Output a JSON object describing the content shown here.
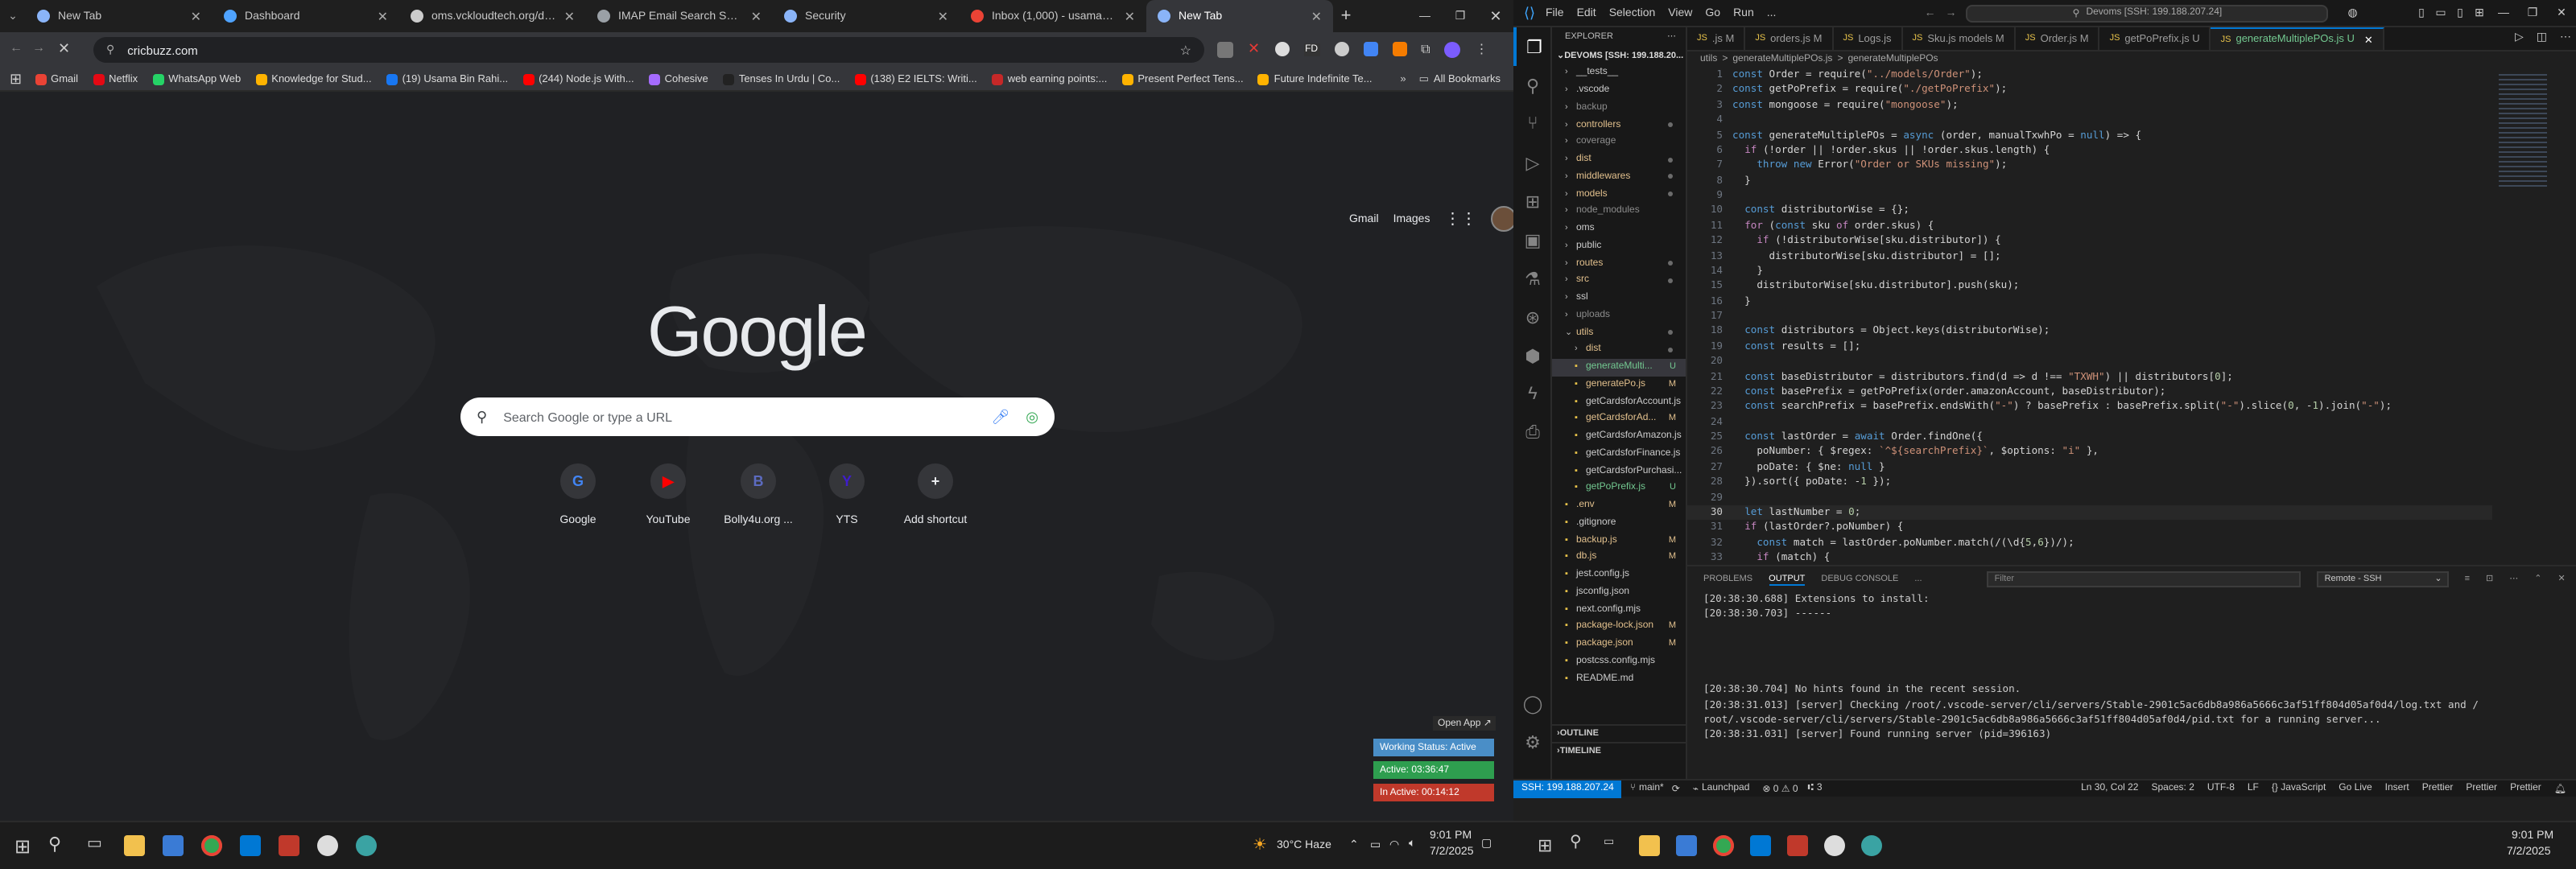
{
  "chrome": {
    "tabs": [
      {
        "label": "New Tab",
        "color": "#8ab4f8",
        "active": false
      },
      {
        "label": "Dashboard",
        "color": "#4fa3ff",
        "active": false
      },
      {
        "label": "oms.vckloudtech.org/dashboard",
        "color": "#cccccc",
        "active": false
      },
      {
        "label": "IMAP Email Search Script",
        "color": "#9aa0a6",
        "active": false
      },
      {
        "label": "Security",
        "color": "#8ab4f8",
        "active": false
      },
      {
        "label": "Inbox (1,000) - usamabin2580...",
        "color": "#ea4335",
        "active": false
      },
      {
        "label": "New Tab",
        "color": "#8ab4f8",
        "active": true
      }
    ],
    "url": "cricbuzz.com",
    "bookmarks": [
      {
        "label": "Gmail",
        "color": "#ea4335"
      },
      {
        "label": "Netflix",
        "color": "#e50914"
      },
      {
        "label": "WhatsApp Web",
        "color": "#25d366"
      },
      {
        "label": "Knowledge for Stud...",
        "color": "#ffb300"
      },
      {
        "label": "(19) Usama Bin Rahi...",
        "color": "#1877f2"
      },
      {
        "label": "(244) Node.js With...",
        "color": "#ff0000"
      },
      {
        "label": "Cohesive",
        "color": "#a56bff"
      },
      {
        "label": "Tenses In Urdu | Co...",
        "color": "#222222"
      },
      {
        "label": "(138) E2 IELTS: Writi...",
        "color": "#ff0000"
      },
      {
        "label": "web earning points:...",
        "color": "#c62828"
      },
      {
        "label": "Present Perfect Tens...",
        "color": "#ffb300"
      },
      {
        "label": "Future Indefinite Te...",
        "color": "#ffb300"
      }
    ],
    "all_bookmarks": "All Bookmarks",
    "gmail": "Gmail",
    "images": "Images",
    "logo": "Google",
    "search_placeholder": "Search Google or type a URL",
    "shortcuts": [
      {
        "label": "Google",
        "glyph": "G",
        "color": "#4285f4"
      },
      {
        "label": "YouTube",
        "glyph": "▶",
        "color": "#ff0000"
      },
      {
        "label": "Bolly4u.org ...",
        "glyph": "B",
        "color": "#5c6bc0"
      },
      {
        "label": "YTS",
        "glyph": "Y",
        "color": "#3f1dcb"
      },
      {
        "label": "Add shortcut",
        "glyph": "+",
        "color": "#e8eaed"
      }
    ],
    "open_app": "Open App ↗",
    "working_status": "Working Status: Active",
    "active_time": "Active: 03:36:47",
    "inactive_time": "In Active: 00:14:12"
  },
  "taskbar": {
    "weather": "30°C  Haze",
    "time_left": "9:01 PM",
    "date_left": "7/2/2025",
    "time_right": "9:01 PM",
    "date_right": "7/2/2025"
  },
  "vscode": {
    "menu": [
      "File",
      "Edit",
      "Selection",
      "View",
      "Go",
      "Run",
      "..."
    ],
    "command_center": "Devoms [SSH: 199.188.207.24]",
    "explorer_title": "EXPLORER",
    "root": "DEVOMS [SSH: 199.188.20...",
    "tree": [
      {
        "label": "__tests__",
        "indent": 1,
        "folder": true,
        "color": "#cccccc",
        "mark": ""
      },
      {
        "label": ".vscode",
        "indent": 1,
        "folder": true,
        "color": "#cccccc",
        "mark": ""
      },
      {
        "label": "backup",
        "indent": 1,
        "folder": true,
        "color": "#8c8c8c",
        "mark": ""
      },
      {
        "label": "controllers",
        "indent": 1,
        "folder": true,
        "color": "#e2c08d",
        "mark": "dot"
      },
      {
        "label": "coverage",
        "indent": 1,
        "folder": true,
        "color": "#8c8c8c",
        "mark": ""
      },
      {
        "label": "dist",
        "indent": 1,
        "folder": true,
        "color": "#e2c08d",
        "mark": "dot"
      },
      {
        "label": "middlewares",
        "indent": 1,
        "folder": true,
        "color": "#e2c08d",
        "mark": "dot"
      },
      {
        "label": "models",
        "indent": 1,
        "folder": true,
        "color": "#e2c08d",
        "mark": "dot"
      },
      {
        "label": "node_modules",
        "indent": 1,
        "folder": true,
        "color": "#8c8c8c",
        "mark": ""
      },
      {
        "label": "oms",
        "indent": 1,
        "folder": true,
        "color": "#cccccc",
        "mark": ""
      },
      {
        "label": "public",
        "indent": 1,
        "folder": true,
        "color": "#cccccc",
        "mark": ""
      },
      {
        "label": "routes",
        "indent": 1,
        "folder": true,
        "color": "#e2c08d",
        "mark": "dot"
      },
      {
        "label": "src",
        "indent": 1,
        "folder": true,
        "color": "#e2c08d",
        "mark": "dot"
      },
      {
        "label": "ssl",
        "indent": 1,
        "folder": true,
        "color": "#cccccc",
        "mark": ""
      },
      {
        "label": "uploads",
        "indent": 1,
        "folder": true,
        "color": "#8c8c8c",
        "mark": ""
      },
      {
        "label": "utils",
        "indent": 1,
        "folder": true,
        "color": "#e2c08d",
        "mark": "dot",
        "open": true
      },
      {
        "label": "dist",
        "indent": 2,
        "folder": true,
        "color": "#e2c08d",
        "mark": "dot"
      },
      {
        "label": "generateMulti...",
        "indent": 2,
        "folder": false,
        "color": "#73c991",
        "mark": "U",
        "selected": true
      },
      {
        "label": "generatePo.js",
        "indent": 2,
        "folder": false,
        "color": "#e2c08d",
        "mark": "M"
      },
      {
        "label": "getCardsforAccount.js",
        "indent": 2,
        "folder": false,
        "color": "#cccccc",
        "mark": ""
      },
      {
        "label": "getCardsforAd...",
        "indent": 2,
        "folder": false,
        "color": "#e2c08d",
        "mark": "M"
      },
      {
        "label": "getCardsforAmazon.js",
        "indent": 2,
        "folder": false,
        "color": "#cccccc",
        "mark": ""
      },
      {
        "label": "getCardsforFinance.js",
        "indent": 2,
        "folder": false,
        "color": "#cccccc",
        "mark": ""
      },
      {
        "label": "getCardsforPurchasi...",
        "indent": 2,
        "folder": false,
        "color": "#cccccc",
        "mark": ""
      },
      {
        "label": "getPoPrefix.js",
        "indent": 2,
        "folder": false,
        "color": "#73c991",
        "mark": "U"
      },
      {
        "label": ".env",
        "indent": 1,
        "folder": false,
        "color": "#e2c08d",
        "mark": "M"
      },
      {
        "label": ".gitignore",
        "indent": 1,
        "folder": false,
        "color": "#cccccc",
        "mark": ""
      },
      {
        "label": "backup.js",
        "indent": 1,
        "folder": false,
        "color": "#e2c08d",
        "mark": "M"
      },
      {
        "label": "db.js",
        "indent": 1,
        "folder": false,
        "color": "#e2c08d",
        "mark": "M"
      },
      {
        "label": "jest.config.js",
        "indent": 1,
        "folder": false,
        "color": "#cccccc",
        "mark": ""
      },
      {
        "label": "jsconfig.json",
        "indent": 1,
        "folder": false,
        "color": "#cccccc",
        "mark": ""
      },
      {
        "label": "next.config.mjs",
        "indent": 1,
        "folder": false,
        "color": "#cccccc",
        "mark": ""
      },
      {
        "label": "package-lock.json",
        "indent": 1,
        "folder": false,
        "color": "#e2c08d",
        "mark": "M"
      },
      {
        "label": "package.json",
        "indent": 1,
        "folder": false,
        "color": "#e2c08d",
        "mark": "M"
      },
      {
        "label": "postcss.config.mjs",
        "indent": 1,
        "folder": false,
        "color": "#cccccc",
        "mark": ""
      },
      {
        "label": "README.md",
        "indent": 1,
        "folder": false,
        "color": "#cccccc",
        "mark": ""
      }
    ],
    "outline": "OUTLINE",
    "timeline": "TIMELINE",
    "editor_tabs": [
      {
        "label": ".js M",
        "active": false
      },
      {
        "label": "orders.js M",
        "active": false
      },
      {
        "label": "Logs.js",
        "active": false
      },
      {
        "label": "Sku.js models M",
        "active": false
      },
      {
        "label": "Order.js M",
        "active": false
      },
      {
        "label": "getPoPrefix.js U",
        "active": false
      },
      {
        "label": "generateMultiplePOs.js U",
        "active": true
      }
    ],
    "breadcrumb": [
      "utils",
      ">",
      "generateMultiplePOs.js",
      ">",
      "generateMultiplePOs"
    ],
    "code_lines": [
      {
        "n": "1",
        "t": "const Order = require(\"../models/Order\");"
      },
      {
        "n": "2",
        "t": "const getPoPrefix = require(\"./getPoPrefix\");"
      },
      {
        "n": "3",
        "t": "const mongoose = require(\"mongoose\");"
      },
      {
        "n": "4",
        "t": ""
      },
      {
        "n": "5",
        "t": "const generateMultiplePOs = async (order, manualTxwhPo = null) => {"
      },
      {
        "n": "6",
        "t": "  if (!order || !order.skus || !order.skus.length) {"
      },
      {
        "n": "7",
        "t": "    throw new Error(\"Order or SKUs missing\");"
      },
      {
        "n": "8",
        "t": "  }"
      },
      {
        "n": "9",
        "t": ""
      },
      {
        "n": "10",
        "t": "  const distributorWise = {};"
      },
      {
        "n": "11",
        "t": "  for (const sku of order.skus) {"
      },
      {
        "n": "12",
        "t": "    if (!distributorWise[sku.distributor]) {"
      },
      {
        "n": "13",
        "t": "      distributorWise[sku.distributor] = [];"
      },
      {
        "n": "14",
        "t": "    }"
      },
      {
        "n": "15",
        "t": "    distributorWise[sku.distributor].push(sku);"
      },
      {
        "n": "16",
        "t": "  }"
      },
      {
        "n": "17",
        "t": ""
      },
      {
        "n": "18",
        "t": "  const distributors = Object.keys(distributorWise);"
      },
      {
        "n": "19",
        "t": "  const results = [];"
      },
      {
        "n": "20",
        "t": ""
      },
      {
        "n": "21",
        "t": "  const baseDistributor = distributors.find(d => d !== \"TXWH\") || distributors[0];"
      },
      {
        "n": "22",
        "t": "  const basePrefix = getPoPrefix(order.amazonAccount, baseDistributor);"
      },
      {
        "n": "23",
        "t": "  const searchPrefix = basePrefix.endsWith(\"-\") ? basePrefix : basePrefix.split(\"-\").slice(0, -1).join(\"-\");"
      },
      {
        "n": "24",
        "t": ""
      },
      {
        "n": "25",
        "t": "  const lastOrder = await Order.findOne({"
      },
      {
        "n": "26",
        "t": "    poNumber: { $regex: `^${searchPrefix}`, $options: \"i\" },"
      },
      {
        "n": "27",
        "t": "    poDate: { $ne: null }"
      },
      {
        "n": "28",
        "t": "  }).sort({ poDate: -1 });"
      },
      {
        "n": "29",
        "t": ""
      },
      {
        "n": "30",
        "t": "  let lastNumber = 0;"
      },
      {
        "n": "31",
        "t": "  if (lastOrder?.poNumber) {"
      },
      {
        "n": "32",
        "t": "    const match = lastOrder.poNumber.match(/(\\d{5,6})/);"
      },
      {
        "n": "33",
        "t": "    if (match) {"
      }
    ],
    "panel_tabs": [
      "PROBLEMS",
      "OUTPUT",
      "DEBUG CONSOLE",
      "..."
    ],
    "filter": "Filter",
    "output_channel": "Remote - SSH",
    "output_lines": [
      "[20:38:30.688] Extensions to install:",
      "[20:38:30.703] ------",
      "",
      "",
      "",
      "",
      "[20:38:30.704] No hints found in the recent session.",
      "[20:38:31.013] [server] Checking /root/.vscode-server/cli/servers/Stable-2901c5ac6db8a986a5666c3af51ff804d05af0d4/log.txt and /",
      "root/.vscode-server/cli/servers/Stable-2901c5ac6db8a986a5666c3af51ff804d05af0d4/pid.txt for a running server...",
      "[20:38:31.031] [server] Found running server (pid=396163)"
    ],
    "status": {
      "remote": "SSH: 199.188.207.24",
      "branch": "main*",
      "launchpad": "Launchpad",
      "errors": "⊗ 0 ⚠ 0",
      "ports": "3",
      "position": "Ln 30, Col 22",
      "spaces": "Spaces: 2",
      "encoding": "UTF-8",
      "eol": "LF",
      "language": "{} JavaScript",
      "golive": "Go Live",
      "insert": "Insert",
      "prettier1": "Prettier",
      "prettier2": "Prettier",
      "prettier3": "Prettier"
    }
  }
}
